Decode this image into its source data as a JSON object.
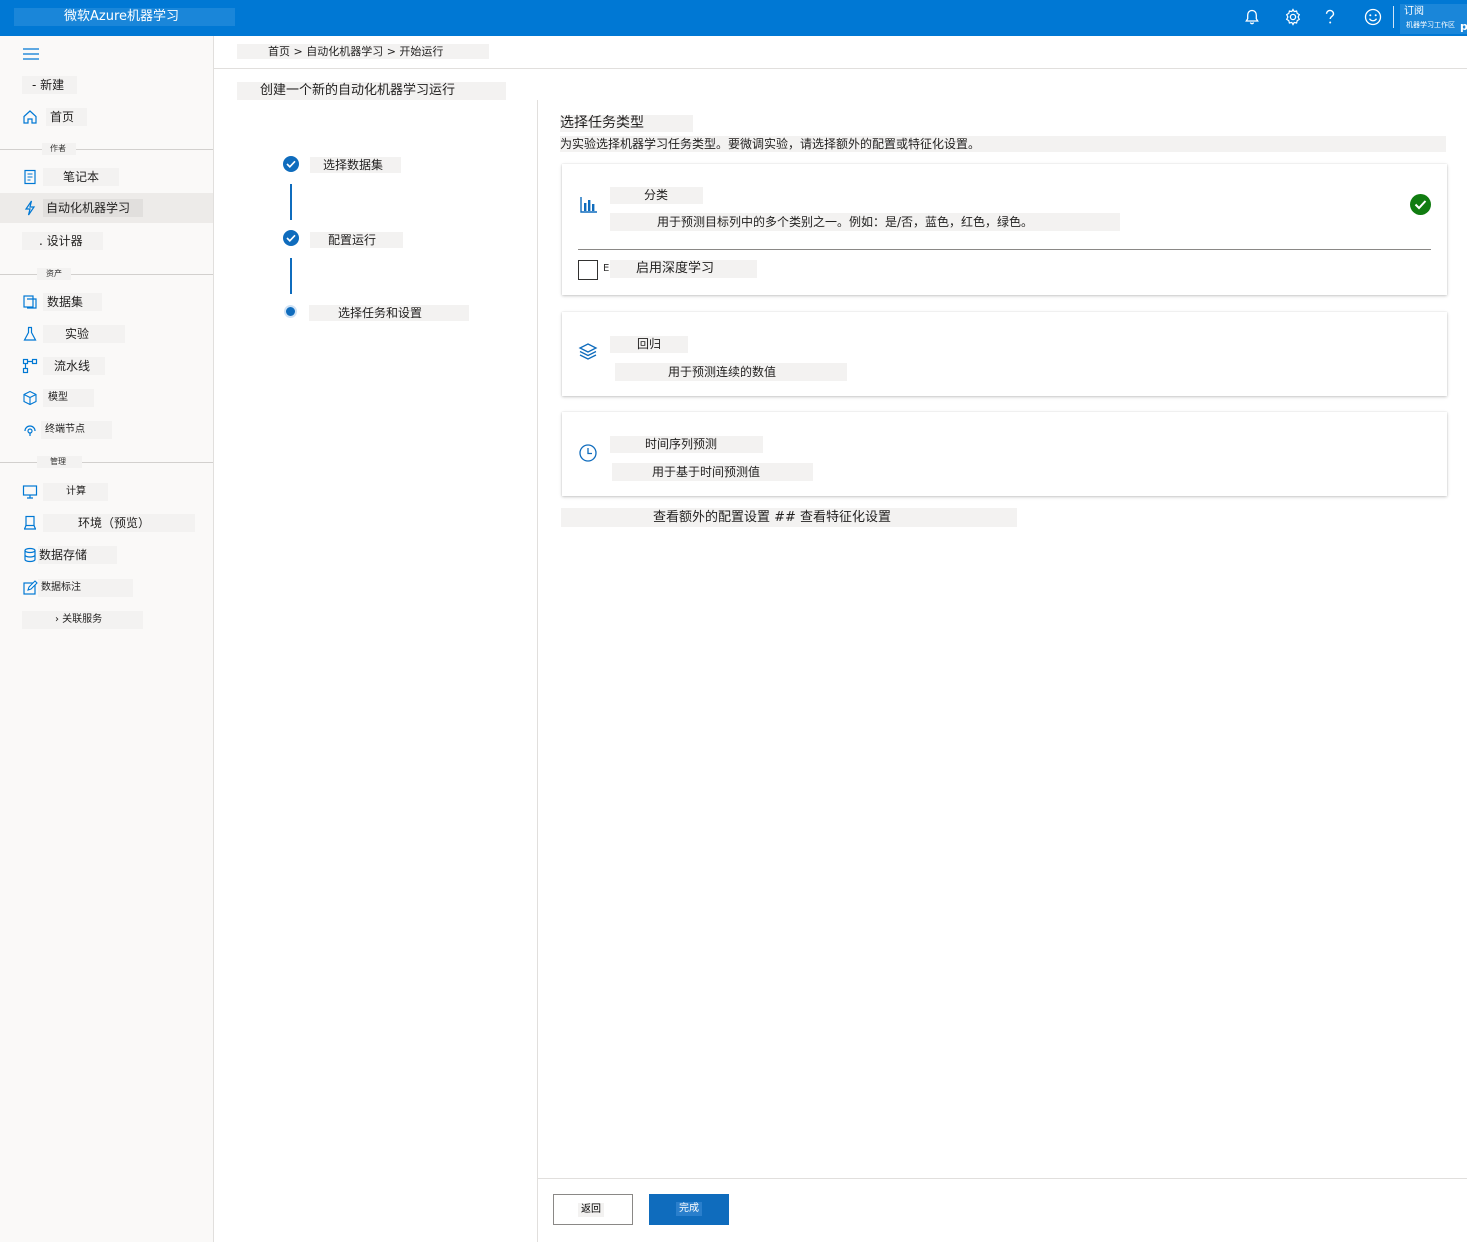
{
  "header": {
    "app_title": "微软Azure机器学习",
    "subscription": "订阅",
    "workspace": "机器学习工作区",
    "user_initial": "p",
    "icons": [
      "bell-icon",
      "gear-icon",
      "help-icon",
      "smiley-icon"
    ]
  },
  "sidebar": {
    "menu_icon": "hamburger-icon",
    "new": "- 新建",
    "home": "首页",
    "section_author": "作者",
    "notebooks": "笔记本",
    "automl": "自动化机器学习",
    "designer": ". 设计器",
    "section_assets": "资产",
    "datasets": "数据集",
    "experiments": "实验",
    "pipelines": "流水线",
    "models": "模型",
    "endpoints": "终端节点",
    "section_manage": "管理",
    "compute": "计算",
    "environments": "环境（预览）",
    "datastores": "数据存储",
    "labeling": "数据标注",
    "linked_services": "› 关联服务"
  },
  "breadcrumb": "首页 > 自动化机器学习 > 开始运行",
  "page_title": "创建一个新的自动化机器学习运行",
  "steps": [
    {
      "label": "选择数据集",
      "state": "done"
    },
    {
      "label": "配置运行",
      "state": "done"
    },
    {
      "label": "选择任务和设置",
      "state": "current"
    }
  ],
  "task": {
    "title": "选择任务类型",
    "description": "为实验选择机器学习任务类型。要微调实验，请选择额外的配置或特征化设置。",
    "options": [
      {
        "title": "分类",
        "description": "用于预测目标列中的多个类别之一。例如：是/否，蓝色，红色，绿色。",
        "icon": "bar-chart-icon",
        "selected": true
      },
      {
        "title": "回归",
        "description": "用于预测连续的数值",
        "icon": "layers-icon",
        "selected": false
      },
      {
        "title": "时间序列预测",
        "description": "用于基于时间预测值",
        "icon": "clock-icon",
        "selected": false
      }
    ],
    "deep_learning_trunc": "E",
    "deep_learning_label": "启用深度学习",
    "deep_learning_checked": false,
    "more_settings": "查看额外的配置设置 ## 查看特征化设置"
  },
  "footer": {
    "back": "返回",
    "finish": "完成"
  },
  "colors": {
    "topbar": "#0078d4",
    "accent": "#0f6cbd",
    "success": "#107c10"
  }
}
